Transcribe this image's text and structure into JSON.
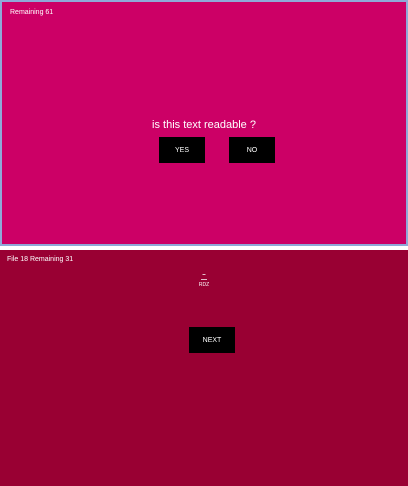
{
  "top": {
    "remaining": "Remaining 61",
    "question": "is this text readable ?",
    "yes": "YES",
    "no": "NO"
  },
  "bottom": {
    "status": "File 18 Remaining 31",
    "sample": {
      "line3": "RDZ"
    },
    "next": "NEXT"
  },
  "colors": {
    "top_bg": "#cc0066",
    "bottom_bg": "#990033",
    "button_bg": "#000000",
    "text": "#ffffff"
  }
}
